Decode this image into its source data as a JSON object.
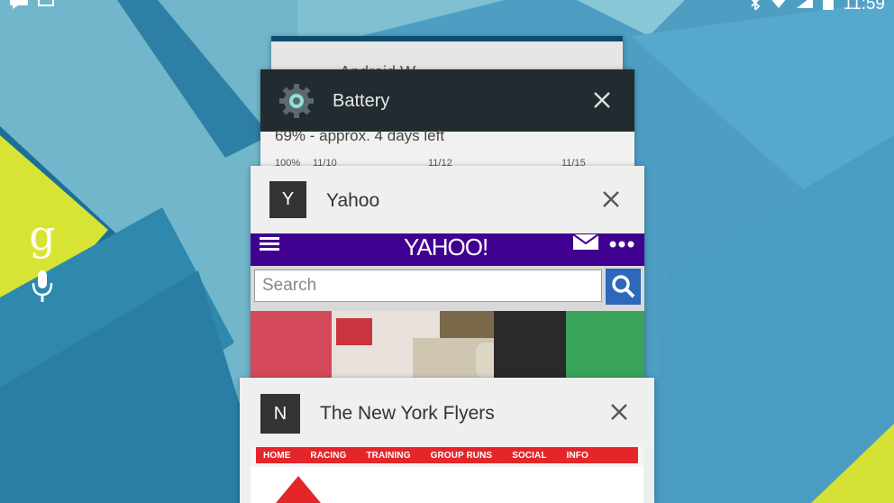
{
  "status_bar": {
    "time": "11:59",
    "icons": [
      "chat-icon",
      "image-icon",
      "bluetooth-icon",
      "wifi-icon",
      "signal-icon",
      "battery-icon"
    ]
  },
  "home": {
    "google_logo": "g",
    "icons": [
      "google-search-icon",
      "mic-icon"
    ]
  },
  "recents": {
    "wear_card": {
      "title": "Android W"
    },
    "battery_card": {
      "title": "Battery",
      "icon": "gear-icon",
      "summary": "69% - approx. 4 days left",
      "axis_labels": [
        "100%",
        "11/10",
        "11/12",
        "11/15"
      ]
    },
    "yahoo_card": {
      "title": "Yahoo",
      "badge_letter": "Y",
      "logo": "YAHOO!",
      "search_placeholder": "Search",
      "icons": [
        "menu-icon",
        "mail-icon",
        "more-icon",
        "search-icon"
      ]
    },
    "flyers_card": {
      "title": "The New York Flyers",
      "badge_letter": "N",
      "nav_items": [
        "HOME",
        "RACING",
        "TRAINING",
        "GROUP RUNS",
        "SOCIAL",
        "INFO"
      ]
    }
  },
  "colors": {
    "yahoo_purple": "#400090",
    "flyers_red": "#e4262a",
    "battery_header": "#222b30",
    "search_button": "#2e68ba"
  }
}
